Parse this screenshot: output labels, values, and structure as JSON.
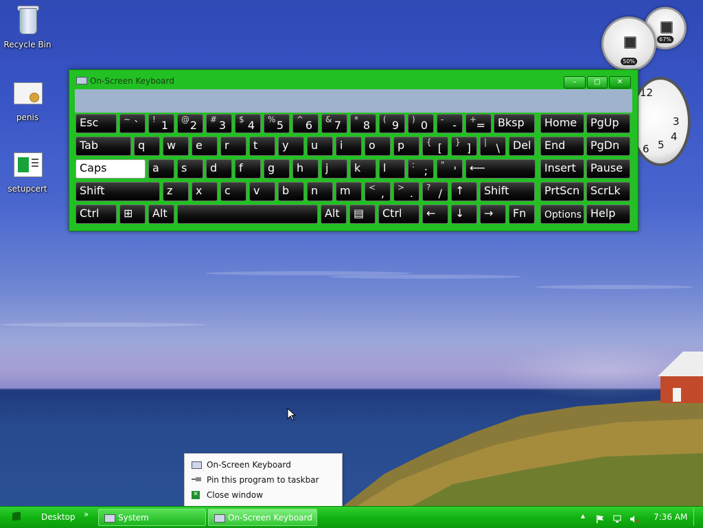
{
  "desktop": {
    "icons": [
      {
        "label": "Recycle Bin"
      },
      {
        "label": "penis"
      },
      {
        "label": "setupcert"
      }
    ]
  },
  "gadgets": {
    "cpu_meter": {
      "cpu_percent": "50%",
      "memory_percent": "67%"
    },
    "clock": {
      "numerals": [
        "12",
        "3",
        "4",
        "5",
        "6"
      ]
    }
  },
  "osk": {
    "title": "On-Screen Keyboard",
    "rows": [
      [
        {
          "label": "Esc"
        },
        {
          "upper": "~",
          "lower": "`"
        },
        {
          "upper": "!",
          "lower": "1"
        },
        {
          "upper": "@",
          "lower": "2"
        },
        {
          "upper": "#",
          "lower": "3"
        },
        {
          "upper": "$",
          "lower": "4"
        },
        {
          "upper": "%",
          "lower": "5"
        },
        {
          "upper": "^",
          "lower": "6"
        },
        {
          "upper": "&",
          "lower": "7"
        },
        {
          "upper": "*",
          "lower": "8"
        },
        {
          "upper": "(",
          "lower": "9"
        },
        {
          "upper": ")",
          "lower": "0"
        },
        {
          "upper": "-",
          "lower": "-"
        },
        {
          "upper": "+",
          "lower": "="
        },
        {
          "label": "Bksp"
        },
        {
          "label": "Home"
        },
        {
          "label": "PgUp"
        }
      ],
      [
        {
          "label": "Tab"
        },
        {
          "label": "q"
        },
        {
          "label": "w"
        },
        {
          "label": "e"
        },
        {
          "label": "r"
        },
        {
          "label": "t"
        },
        {
          "label": "y"
        },
        {
          "label": "u"
        },
        {
          "label": "i"
        },
        {
          "label": "o"
        },
        {
          "label": "p"
        },
        {
          "upper": "{",
          "lower": "["
        },
        {
          "upper": "}",
          "lower": "]"
        },
        {
          "upper": "|",
          "lower": "\\"
        },
        {
          "label": "Del"
        },
        {
          "label": "End"
        },
        {
          "label": "PgDn"
        }
      ],
      [
        {
          "label": "Caps"
        },
        {
          "label": "a"
        },
        {
          "label": "s"
        },
        {
          "label": "d"
        },
        {
          "label": "f"
        },
        {
          "label": "g"
        },
        {
          "label": "h"
        },
        {
          "label": "j"
        },
        {
          "label": "k"
        },
        {
          "label": "l"
        },
        {
          "upper": ":",
          "lower": ";"
        },
        {
          "upper": "\"",
          "lower": "'"
        },
        {
          "label": "⟵"
        },
        {
          "label": "Insert"
        },
        {
          "label": "Pause"
        }
      ],
      [
        {
          "label": "Shift"
        },
        {
          "label": "z"
        },
        {
          "label": "x"
        },
        {
          "label": "c"
        },
        {
          "label": "v"
        },
        {
          "label": "b"
        },
        {
          "label": "n"
        },
        {
          "label": "m"
        },
        {
          "upper": "<",
          "lower": ","
        },
        {
          "upper": ">",
          "lower": "."
        },
        {
          "upper": "?",
          "lower": "/"
        },
        {
          "label": "↑"
        },
        {
          "label": "Shift"
        },
        {
          "label": "PrtScn"
        },
        {
          "label": "ScrLk"
        }
      ],
      [
        {
          "label": "Ctrl"
        },
        {
          "label": "⊞"
        },
        {
          "label": "Alt"
        },
        {
          "label": ""
        },
        {
          "label": "Alt"
        },
        {
          "label": "▤"
        },
        {
          "label": "Ctrl"
        },
        {
          "label": "←"
        },
        {
          "label": "↓"
        },
        {
          "label": "→"
        },
        {
          "label": "Fn"
        },
        {
          "label": "Options"
        },
        {
          "label": "Help"
        }
      ]
    ]
  },
  "context_menu": {
    "items": [
      {
        "label": "On-Screen Keyboard",
        "icon": "keyboard-icon"
      },
      {
        "label": "Pin this program to taskbar",
        "icon": "pin-icon"
      },
      {
        "label": "Close window",
        "icon": "close-icon"
      }
    ]
  },
  "taskbar": {
    "desktop_label": "Desktop",
    "overflow": "»",
    "buttons": [
      {
        "label": "System"
      },
      {
        "label": "On-Screen Keyboard"
      }
    ],
    "clock": "7:36 AM",
    "tray_up": "▲"
  }
}
